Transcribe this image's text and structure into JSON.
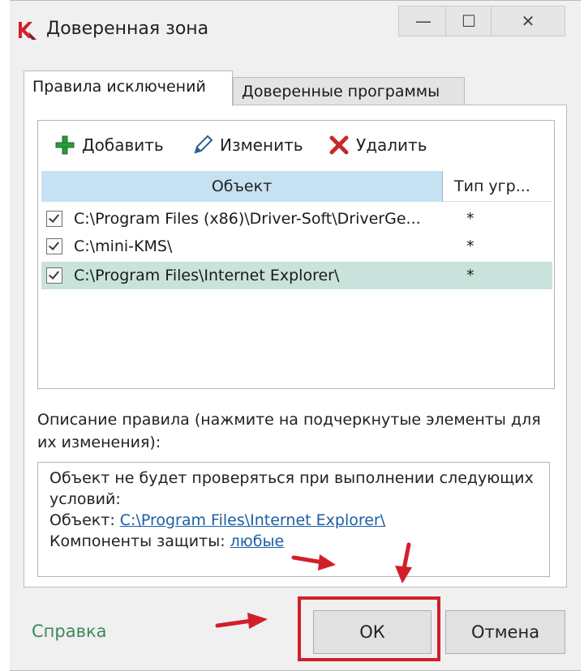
{
  "window": {
    "title": "Доверенная зона",
    "controls": {
      "minimize": "—",
      "maximize": "☐",
      "close": "✕"
    }
  },
  "tabs": [
    {
      "label": "Правила исключений",
      "active": true
    },
    {
      "label": "Доверенные программы",
      "active": false
    }
  ],
  "toolbar": {
    "add": "Добавить",
    "edit": "Изменить",
    "delete": "Удалить"
  },
  "table": {
    "columns": [
      "Объект",
      "Тип угр..."
    ],
    "rows": [
      {
        "checked": true,
        "path": "C:\\Program Files (x86)\\Driver-Soft\\DriverGe...",
        "type": "*"
      },
      {
        "checked": true,
        "path": "C:\\mini-KMS\\",
        "type": "*"
      },
      {
        "checked": true,
        "path": "C:\\Program Files\\Internet Explorer\\",
        "type": "*",
        "selected": true
      }
    ]
  },
  "description": {
    "label": "Описание правила (нажмите на подчеркнутые элементы для их изменения):",
    "line1": "Объект не будет проверяться при выполнении следующих условий:",
    "object_label": "Объект: ",
    "object_value": "C:\\Program Files\\Internet Explorer\\",
    "components_label": "Компоненты защиты: ",
    "components_value": "любые"
  },
  "footer": {
    "help": "Справка",
    "ok": "ОК",
    "cancel": "Отмена"
  },
  "colors": {
    "selection": "#c9e3dc",
    "header": "#c6e1f1",
    "link": "#1a5fa6",
    "help": "#3a8a5a",
    "annotation": "#d11f2a"
  }
}
